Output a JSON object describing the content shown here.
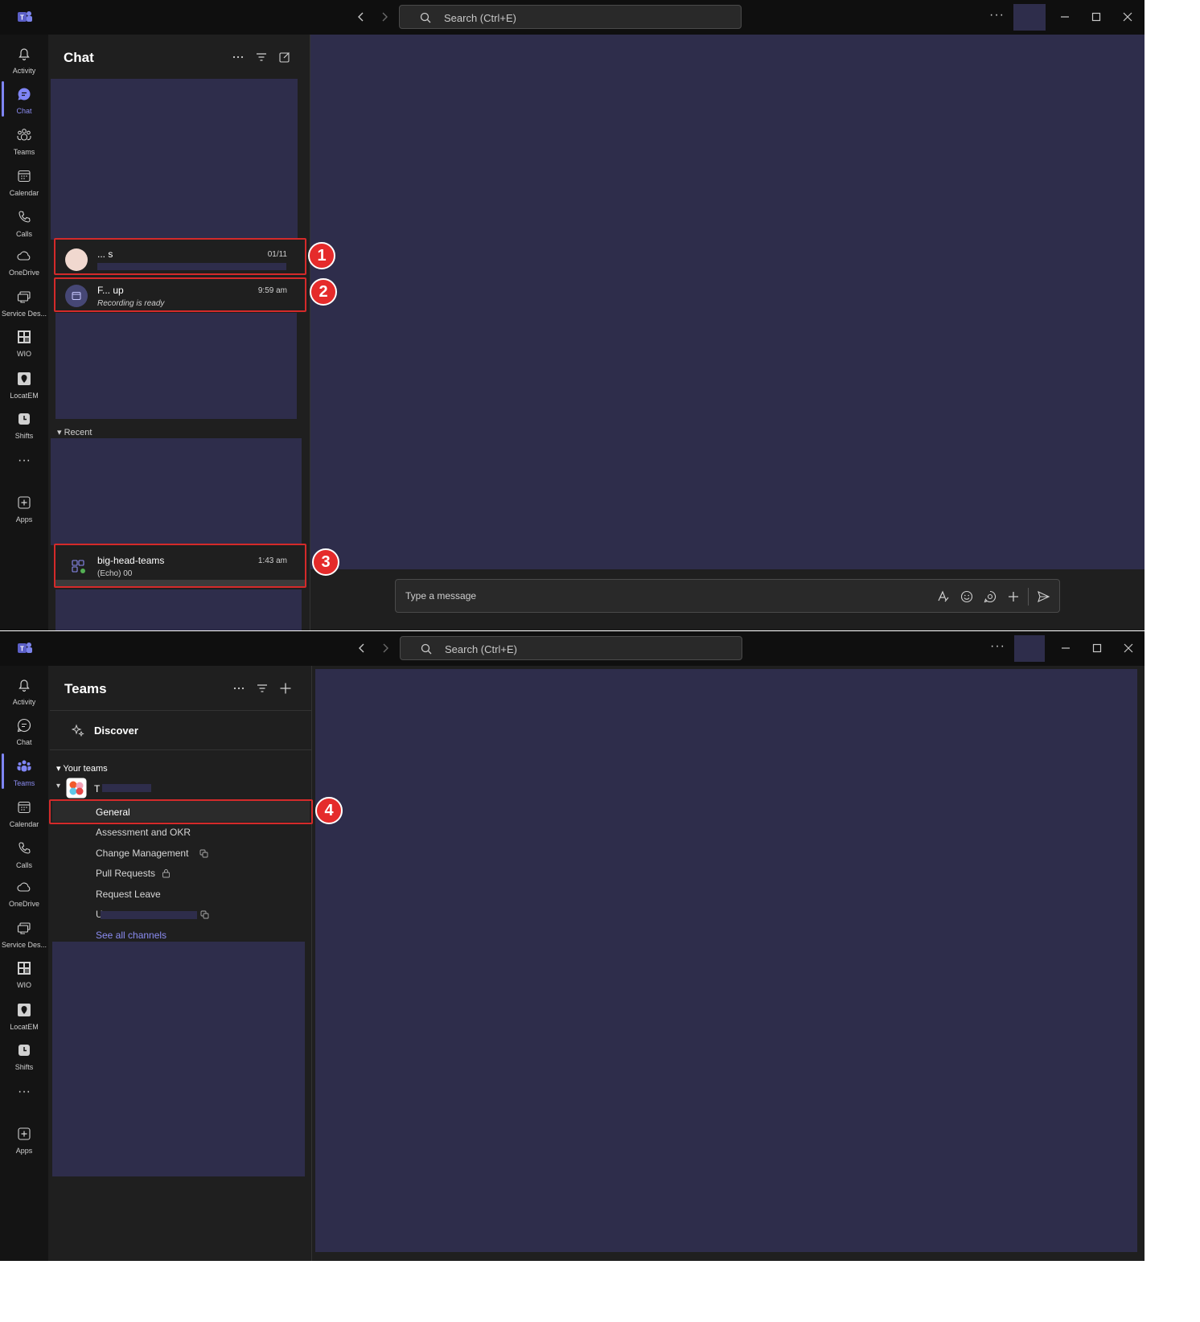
{
  "titlebar": {
    "search_placeholder": "Search (Ctrl+E)",
    "more_label": "···"
  },
  "rail": {
    "items": [
      {
        "label": "Activity",
        "icon": "bell-icon"
      },
      {
        "label": "Chat",
        "icon": "chat-icon"
      },
      {
        "label": "Teams",
        "icon": "teams-icon"
      },
      {
        "label": "Calendar",
        "icon": "calendar-icon"
      },
      {
        "label": "Calls",
        "icon": "phone-icon"
      },
      {
        "label": "OneDrive",
        "icon": "cloud-icon"
      },
      {
        "label": "Service Des...",
        "icon": "service-desk-icon"
      },
      {
        "label": "WIO",
        "icon": "wio-icon"
      },
      {
        "label": "LocatEM",
        "icon": "location-icon"
      },
      {
        "label": "Shifts",
        "icon": "clock-icon"
      },
      {
        "label": "Apps",
        "icon": "add-apps-icon"
      }
    ],
    "more_label": "···"
  },
  "chat_view": {
    "title": "Chat",
    "items": [
      {
        "name": "... s",
        "time": "01/11",
        "preview": "",
        "avatar": "person-avatar"
      },
      {
        "name": "F... up",
        "time": "9:59 am",
        "preview": "Recording is ready",
        "avatar": "meeting-avatar"
      },
      {
        "name": "big-head-teams",
        "time": "1:43 am",
        "preview": "(Echo) 00",
        "avatar": "bot-avatar"
      }
    ],
    "recent_label": "Recent",
    "compose_placeholder": "Type a message"
  },
  "teams_view": {
    "title": "Teams",
    "discover_label": "Discover",
    "your_teams_label": "Your teams",
    "team_name": "T",
    "channels": [
      "General",
      "Assessment and OKR",
      "Change Management",
      "Pull Requests",
      "Request Leave",
      "U"
    ],
    "see_all_label": "See all channels"
  },
  "badges": [
    "1",
    "2",
    "3",
    "4"
  ],
  "colors": {
    "accent": "#7f85f5",
    "placeholder_block": "#2e2d4b",
    "highlight": "#d42a2a",
    "badge": "#e52b2b"
  }
}
